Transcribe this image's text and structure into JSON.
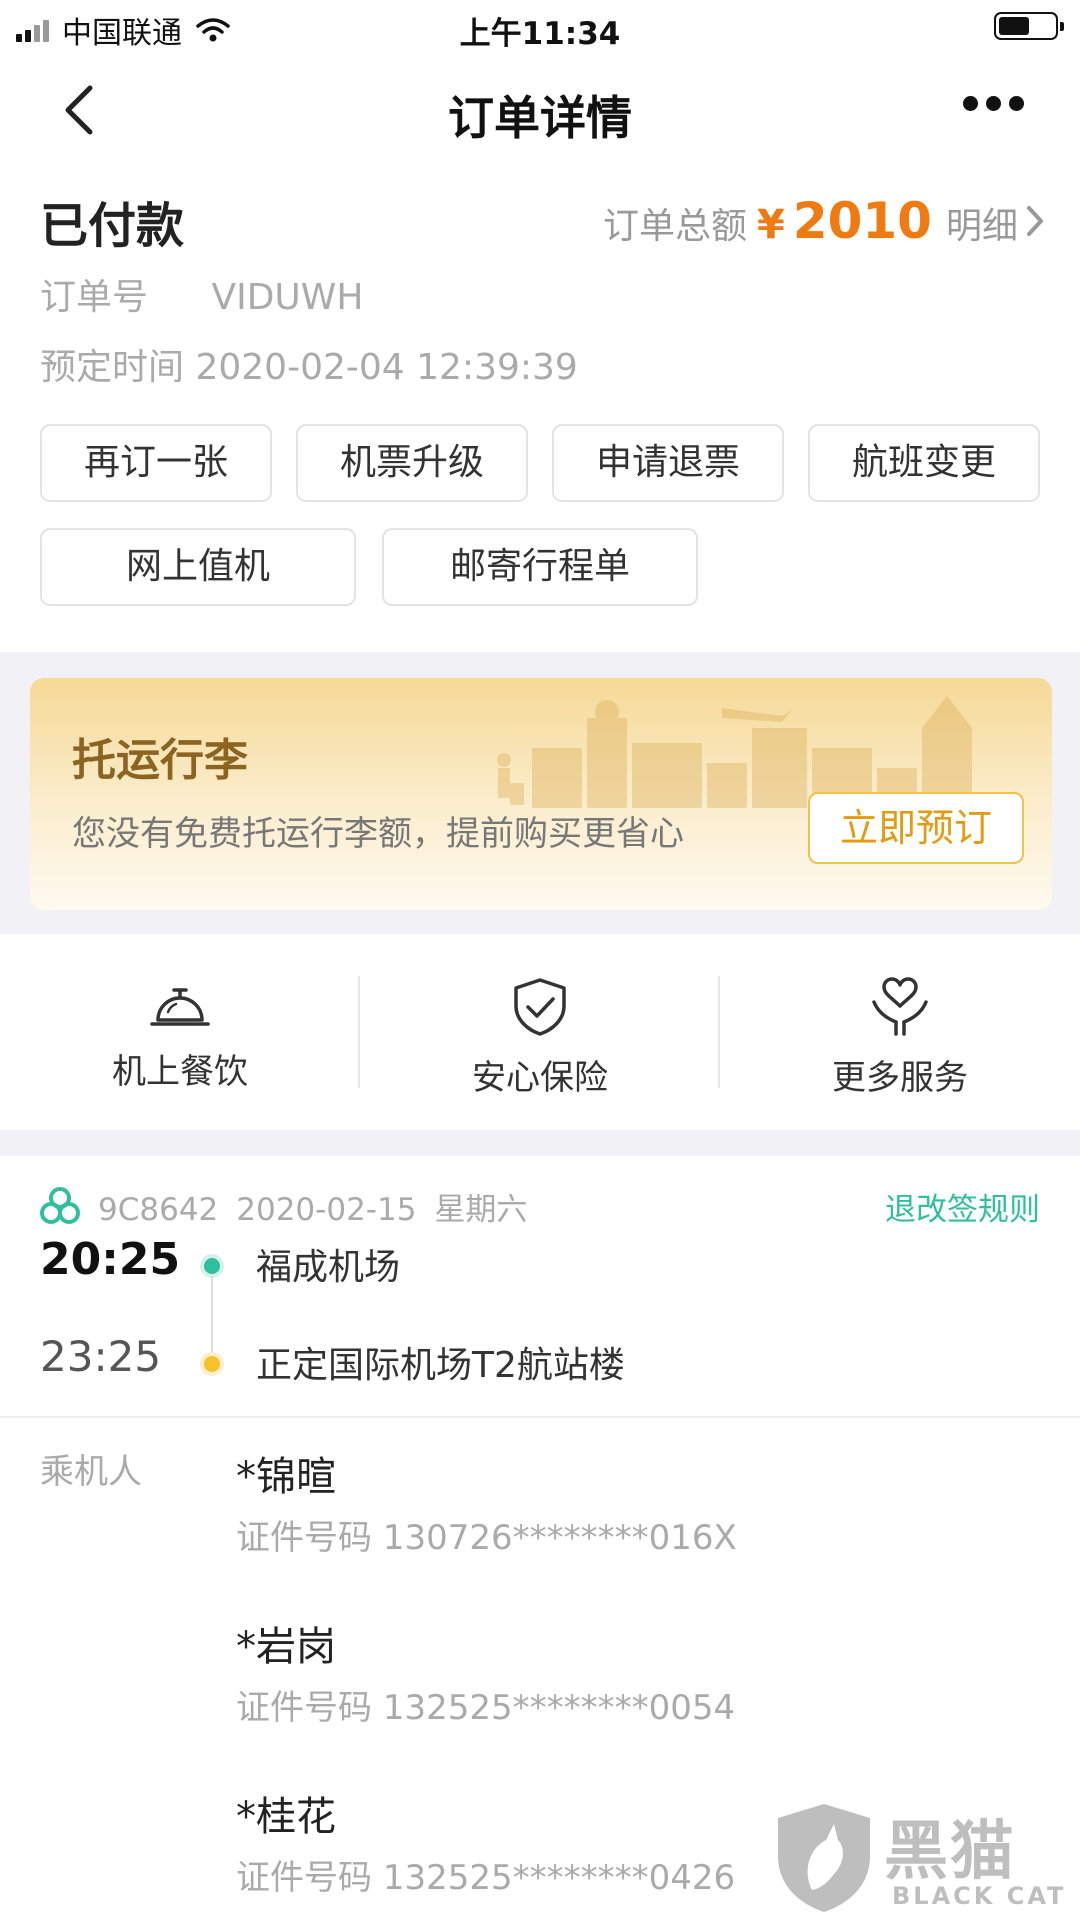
{
  "status_bar": {
    "carrier": "中国联通",
    "time": "上午11:34"
  },
  "nav": {
    "title": "订单详情",
    "back_icon": "chevron-left-icon",
    "more_icon": "more-dots-icon"
  },
  "order": {
    "status": "已付款",
    "total_label": "订单总额",
    "currency": "¥",
    "total": "2010",
    "detail_label": "明细",
    "number_label": "订单号",
    "number": "VIDUWH",
    "booking_time_label": "预定时间",
    "booking_time": "2020-02-04 12:39:39"
  },
  "actions": [
    "再订一张",
    "机票升级",
    "申请退票",
    "航班变更",
    "网上值机",
    "邮寄行程单"
  ],
  "baggage": {
    "title": "托运行李",
    "description": "您没有免费托运行李额，提前购买更省心",
    "button": "立即预订"
  },
  "services": [
    {
      "label": "机上餐饮",
      "icon": "service-bell-icon"
    },
    {
      "label": "安心保险",
      "icon": "shield-check-icon"
    },
    {
      "label": "更多服务",
      "icon": "heart-hands-icon"
    }
  ],
  "flight": {
    "number": "9C8642",
    "date": "2020-02-15",
    "weekday": "星期六",
    "rules_link": "退改签规则",
    "departure_time": "20:25",
    "departure_airport": "福成机场",
    "arrival_time": "23:25",
    "arrival_airport": "正定国际机场T2航站楼"
  },
  "passengers": {
    "label": "乘机人",
    "id_label": "证件号码",
    "list": [
      {
        "name": "*锦暄",
        "id": "130726********016X"
      },
      {
        "name": "*岩岗",
        "id": "132525********0054"
      },
      {
        "name": "*桂花",
        "id": "132525********0426"
      }
    ]
  },
  "watermark": {
    "text": "黑猫",
    "subtext": "BLACK CAT"
  },
  "colors": {
    "accent_orange": "#f07a12",
    "accent_green": "#2fbf9f",
    "gold": "#e49b12"
  }
}
